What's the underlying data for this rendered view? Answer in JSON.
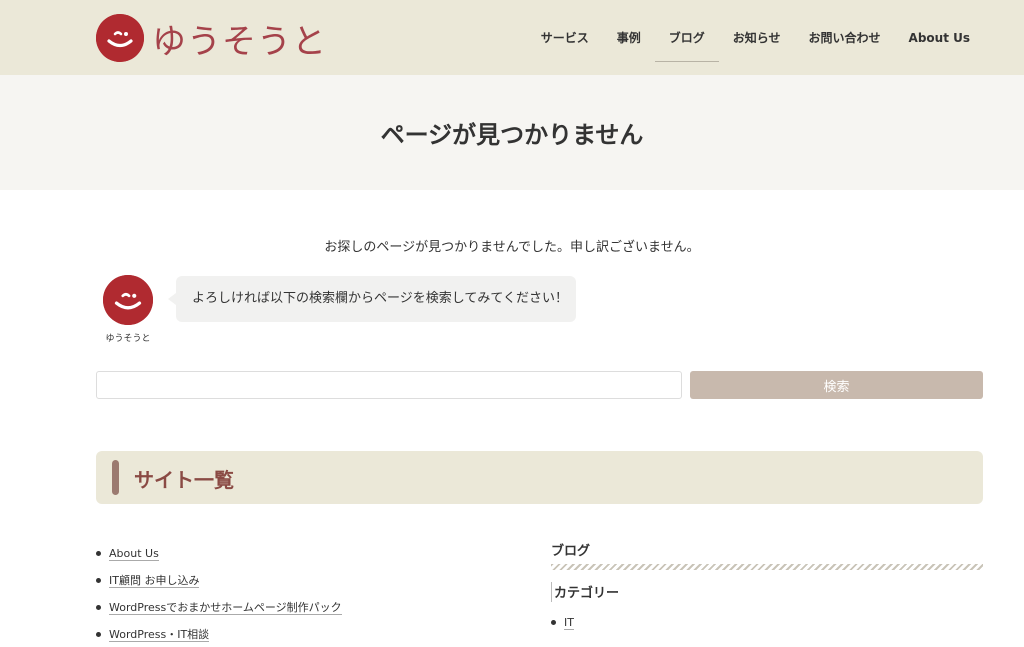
{
  "header": {
    "logo_text": "ゆうそうと",
    "nav": [
      "サービス",
      "事例",
      "ブログ",
      "お知らせ",
      "お問い合わせ",
      "About Us"
    ],
    "active_nav": "ブログ"
  },
  "main": {
    "page_title": "ページが見つかりません",
    "lead": "お探しのページが見つかりませんでした。申し訳ございません。",
    "speech": {
      "name": "ゆうそうと",
      "text": "よろしければ以下の検索欄からページを検索してみてください！"
    },
    "search": {
      "value": "",
      "button_label": "検索"
    },
    "section_title": "サイト一覧",
    "left_links": [
      "About Us",
      "IT顧問 お申し込み",
      "WordPressでおまかせホームページ制作パック",
      "WordPress・IT相談"
    ],
    "right": {
      "blog_heading": "ブログ",
      "category_heading": "カテゴリー",
      "categories": [
        "IT"
      ]
    }
  },
  "colors": {
    "header_bg": "#ebe8d8",
    "brand_red": "#b02a30",
    "search_button": "#c8b9ad",
    "section_title": "#8a4a44"
  }
}
